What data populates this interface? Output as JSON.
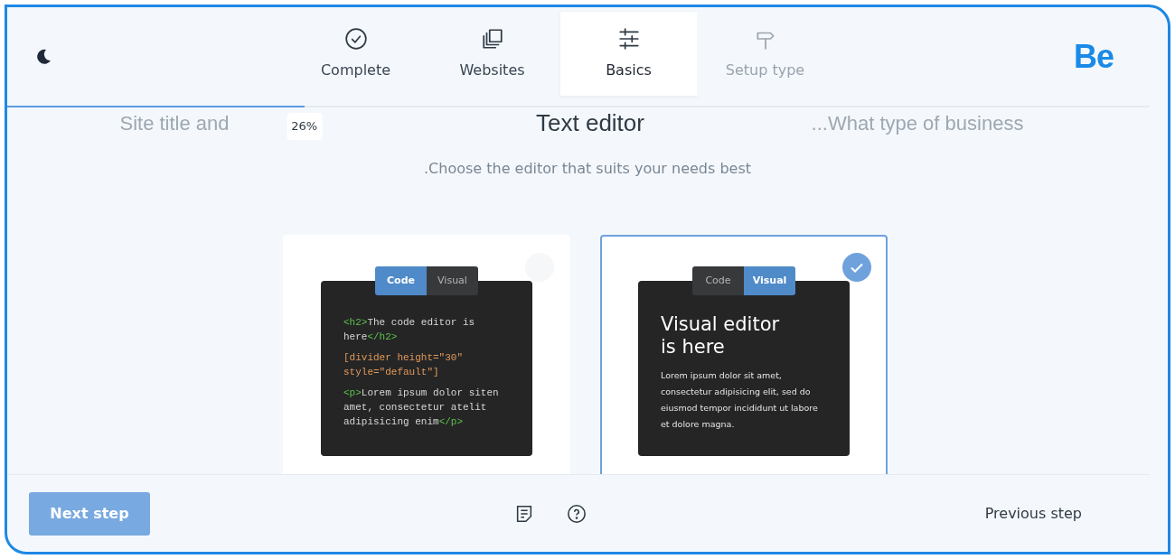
{
  "theme_toggle": {
    "kind": "moon"
  },
  "tabs": [
    {
      "label": "Complete",
      "selected": false,
      "disabled": false
    },
    {
      "label": "Websites",
      "selected": false,
      "disabled": false
    },
    {
      "label": "Basics",
      "selected": true,
      "disabled": false
    },
    {
      "label": "Setup type",
      "selected": false,
      "disabled": true
    }
  ],
  "logo": "Be",
  "progress": {
    "level": 0.26,
    "reading": "26%"
  },
  "steps": {
    "previous": "Site title and",
    "current": "Text editor",
    "next": "...What type of business"
  },
  "subtitle": ".Choose the editor that suits your needs best",
  "cards": [
    {
      "kind": "code",
      "selected": false,
      "tabs": [
        {
          "label": "Code",
          "selected": true
        },
        {
          "label": "Visual",
          "selected": false
        }
      ],
      "paragraphs": [
        [
          {
            "kind": "tag",
            "text": "<h2>"
          },
          {
            "kind": "text",
            "text": "The code editor is here"
          },
          {
            "kind": "tag",
            "text": "</h2>"
          }
        ],
        [
          {
            "kind": "shortcode",
            "text": "[divider height=\"30\" style=\"default\"]"
          }
        ],
        [
          {
            "kind": "tag",
            "text": "<p>"
          },
          {
            "kind": "text",
            "text": "Lorem ipsum dolor siten amet, consectetur atelit adipisicing enim"
          },
          {
            "kind": "tag",
            "text": "</p>"
          }
        ]
      ]
    },
    {
      "kind": "visual",
      "selected": true,
      "tabs": [
        {
          "label": "Code",
          "selected": false
        },
        {
          "label": "Visual",
          "selected": true
        }
      ],
      "heading": "Visual editor is here",
      "body": "Lorem ipsum dolor sit amet, consectetur adipisicing elit, sed do eiusmod tempor incididunt ut labore et dolore magna."
    }
  ],
  "footer": {
    "next_button": "Next step",
    "previous_button": "Previous step"
  }
}
